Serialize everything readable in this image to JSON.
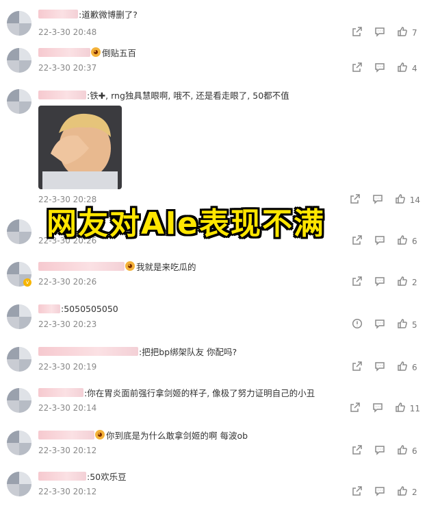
{
  "comments": [
    {
      "text": ":道歉微博删了?",
      "time": "22-3-30 20:48",
      "likes": "7",
      "pre_emoji": false
    },
    {
      "text": "倒贴五百",
      "time": "22-3-30 20:37",
      "likes": "4",
      "pre_emoji": true
    },
    {
      "text": ":铁✚, rng独具慧眼啊, 哦不, 还是看走眼了, 50都不值",
      "time": "22-3-30 20:28",
      "likes": "14",
      "pre_emoji": false
    },
    {
      "text": "",
      "time": "22-3-30 20:26",
      "likes": "6",
      "pre_emoji": false
    },
    {
      "text": "我就是来吃瓜的",
      "time": "22-3-30 20:26",
      "likes": "2",
      "pre_emoji": true
    },
    {
      "text": ":5050505050",
      "time": "22-3-30 20:23",
      "likes": "5",
      "pre_emoji": false
    },
    {
      "text": ":把把bp绑架队友 你配吗?",
      "time": "22-3-30 20:19",
      "likes": "6",
      "pre_emoji": false
    },
    {
      "text": ":你在胃炎面前强行拿剑姬的样子, 像极了努力证明自己的小丑",
      "time": "22-3-30 20:14",
      "likes": "11",
      "pre_emoji": false
    },
    {
      "text": "你到底是为什么敢拿剑姬的啊 每波ob",
      "time": "22-3-30 20:12",
      "likes": "6",
      "pre_emoji": true
    },
    {
      "text": ":50欢乐豆",
      "time": "22-3-30 20:12",
      "likes": "2",
      "pre_emoji": false
    }
  ],
  "overlay_caption": "网友对Ale表现不满",
  "icons": [
    "share-icon",
    "comment-icon",
    "like-icon",
    "report-icon"
  ],
  "colors": {
    "caption": "#ffe600",
    "caption_outline": "#000000",
    "time": "#888888"
  }
}
